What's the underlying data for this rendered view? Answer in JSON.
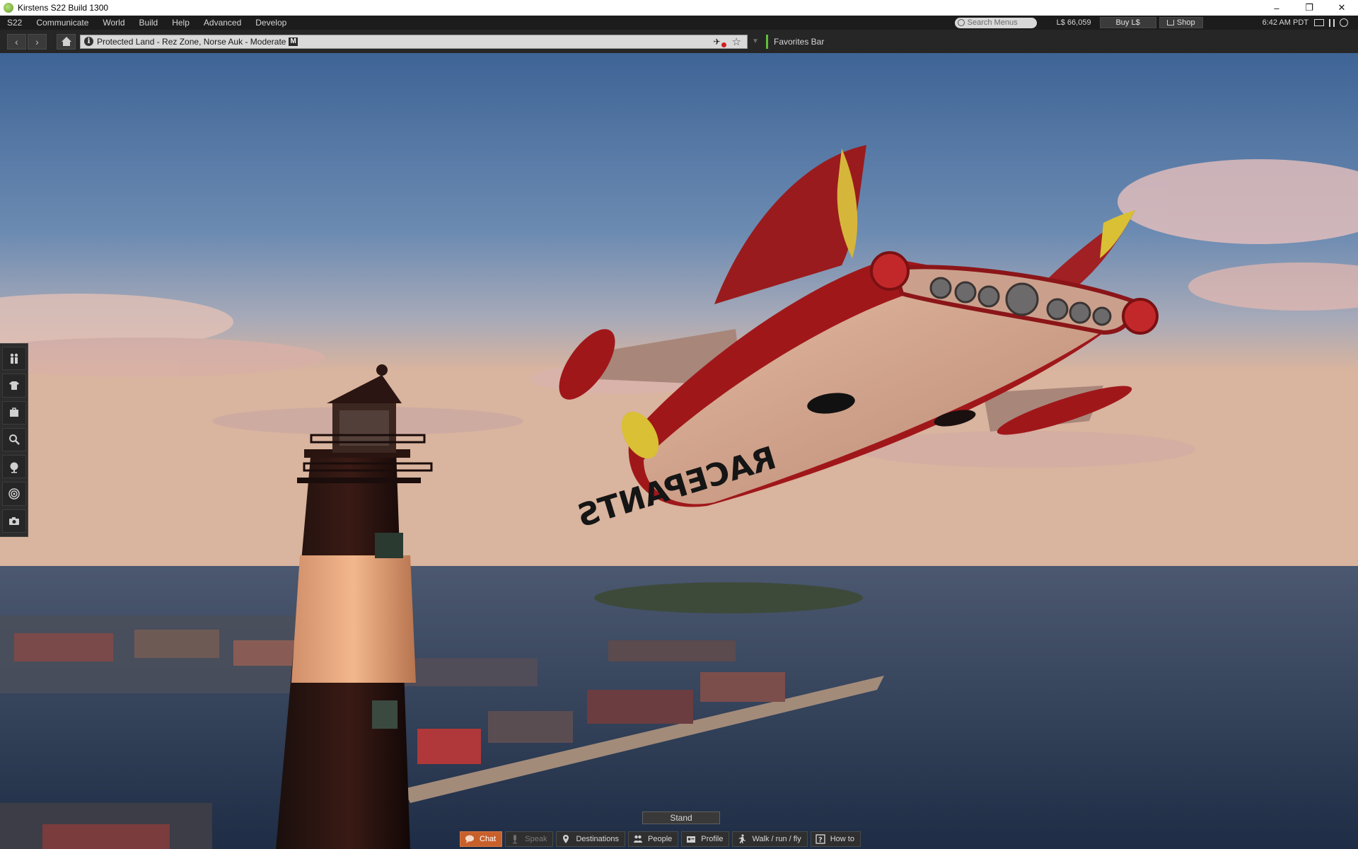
{
  "window": {
    "title": "Kirstens S22 Build 1300",
    "controls": {
      "minimize": "–",
      "restore": "❐",
      "close": "✕"
    }
  },
  "menubar": {
    "items": [
      "S22",
      "Communicate",
      "World",
      "Build",
      "Help",
      "Advanced",
      "Develop"
    ],
    "search_placeholder": "Search Menus",
    "balance": "L$ 66,059",
    "buy_label": "Buy L$",
    "shop_label": "Shop",
    "clock": "6:42 AM PDT"
  },
  "navbar": {
    "back_icon": "‹",
    "forward_icon": "›",
    "location": "Protected Land - Rez Zone, Norse Auk - Moderate",
    "maturity_badge": "M",
    "favorites_label": "Favorites Bar",
    "star_icon": "☆",
    "dropdown_icon": "▼"
  },
  "scene": {
    "aircraft_decal": "RACEPANTS",
    "colors": {
      "sky_top": "#3e6496",
      "sky_horizon": "#d9b49e",
      "water": "#2f3f57",
      "plane_red": "#a0171a",
      "plane_belly": "#cf9f86"
    }
  },
  "stand_label": "Stand",
  "bottom_toolbar": {
    "buttons": [
      "Chat",
      "Speak",
      "Destinations",
      "People",
      "Profile",
      "Walk / run / fly",
      "How to"
    ]
  },
  "left_toolbar": {
    "icons": [
      "avatar-icon",
      "appearance-icon",
      "inventory-icon",
      "search-icon",
      "map-icon",
      "radar-icon",
      "snapshot-icon"
    ]
  }
}
